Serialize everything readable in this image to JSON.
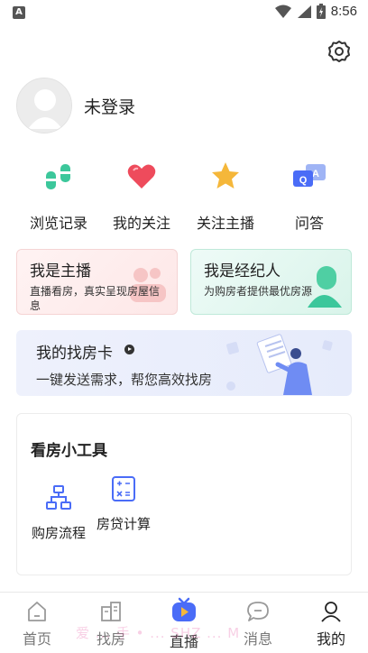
{
  "status_bar": {
    "time": "8:56",
    "left_badge": "A"
  },
  "profile": {
    "username": "未登录"
  },
  "quick_links": [
    {
      "label": "浏览记录",
      "icon": "footprints-icon"
    },
    {
      "label": "我的关注",
      "icon": "heart-icon"
    },
    {
      "label": "关注主播",
      "icon": "star-icon"
    },
    {
      "label": "问答",
      "icon": "qa-icon"
    }
  ],
  "roles": {
    "anchor": {
      "title": "我是主播",
      "subtitle": "直播看房，真实呈现房屋信息"
    },
    "agent": {
      "title": "我是经纪人",
      "subtitle": "为购房者提供最优房源"
    }
  },
  "find_card": {
    "title": "我的找房卡",
    "subtitle": "一键发送需求，帮您高效找房"
  },
  "tools": {
    "title": "看房小工具",
    "items": [
      {
        "label": "购房流程",
        "icon": "flowchart-icon"
      },
      {
        "label": "房贷计算",
        "icon": "calculator-icon"
      }
    ]
  },
  "bottom_nav": [
    {
      "label": "首页",
      "icon": "home-icon"
    },
    {
      "label": "找房",
      "icon": "buildings-icon"
    },
    {
      "label": "直播",
      "icon": "live-tv-icon"
    },
    {
      "label": "消息",
      "icon": "message-icon"
    },
    {
      "label": "我的",
      "icon": "person-icon",
      "active": true
    }
  ],
  "watermark": "爱 ... 手 • ... SHZ ... M",
  "colors": {
    "accent_blue": "#4a6cf7",
    "heart_red": "#ee4b5c",
    "star_yellow": "#f5b73a",
    "teal": "#3cc79b"
  }
}
